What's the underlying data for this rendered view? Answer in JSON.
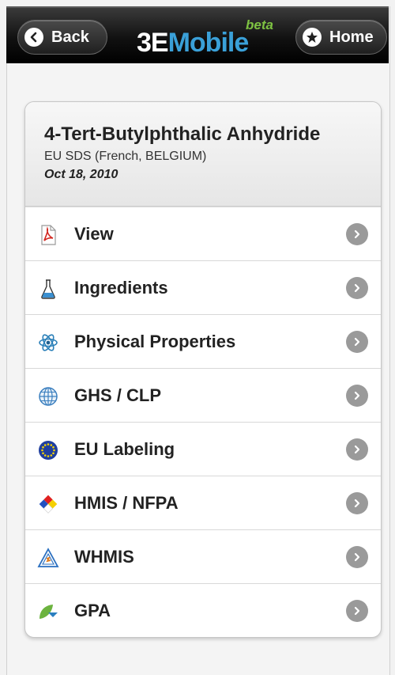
{
  "header": {
    "back_label": "Back",
    "home_label": "Home",
    "logo_three": "3E",
    "logo_mobile": "Mobile",
    "logo_beta": "beta"
  },
  "document": {
    "title": "4-Tert-Butylphthalic Anhydride",
    "subtitle": "EU SDS (French, BELGIUM)",
    "date": "Oct 18, 2010"
  },
  "menu": {
    "items": [
      {
        "label": "View",
        "icon": "pdf-icon"
      },
      {
        "label": "Ingredients",
        "icon": "flask-icon"
      },
      {
        "label": "Physical Properties",
        "icon": "atom-icon"
      },
      {
        "label": "GHS / CLP",
        "icon": "globe-icon"
      },
      {
        "label": "EU Labeling",
        "icon": "eu-flag-icon"
      },
      {
        "label": "HMIS / NFPA",
        "icon": "nfpa-diamond-icon"
      },
      {
        "label": "WHMIS",
        "icon": "whmis-icon"
      },
      {
        "label": "GPA",
        "icon": "gpa-leaf-icon"
      }
    ]
  },
  "colors": {
    "accent_blue": "#3aa0d8",
    "beta_green": "#7ec242",
    "arrow_gray": "#9a9a9a"
  }
}
